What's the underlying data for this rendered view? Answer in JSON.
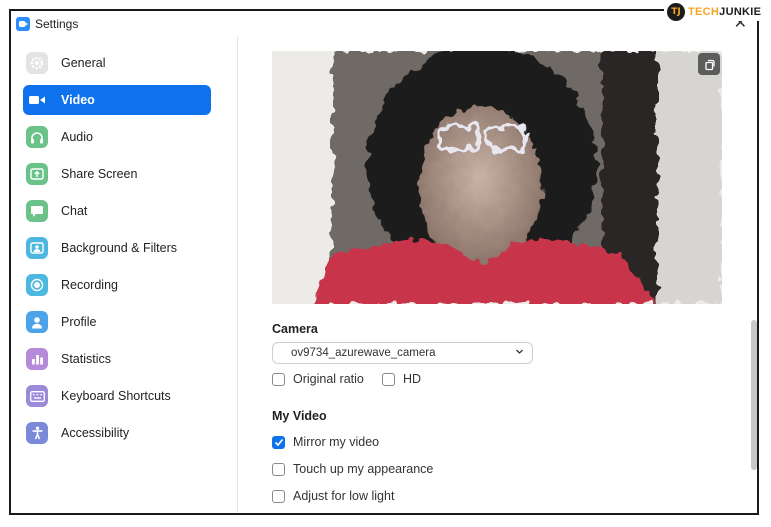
{
  "window": {
    "title": "Settings",
    "close": "✕"
  },
  "watermark": {
    "badge": "TJ",
    "part1": "TECH",
    "part2": "JUNKIE"
  },
  "sidebar": {
    "items": [
      {
        "label": "General",
        "icon": "gear-icon",
        "color": "#e0e0e0"
      },
      {
        "label": "Video",
        "icon": "video-camera-icon",
        "color": "#0e72ed",
        "active": true
      },
      {
        "label": "Audio",
        "icon": "headphones-icon",
        "color": "#6cc38a"
      },
      {
        "label": "Share Screen",
        "icon": "share-screen-icon",
        "color": "#6cc38a"
      },
      {
        "label": "Chat",
        "icon": "chat-bubble-icon",
        "color": "#6cc38a"
      },
      {
        "label": "Background & Filters",
        "icon": "background-icon",
        "color": "#4cb7df"
      },
      {
        "label": "Recording",
        "icon": "recording-icon",
        "color": "#4cb7df"
      },
      {
        "label": "Profile",
        "icon": "profile-icon",
        "color": "#4ca3ea"
      },
      {
        "label": "Statistics",
        "icon": "statistics-icon",
        "color": "#b48ad9"
      },
      {
        "label": "Keyboard Shortcuts",
        "icon": "keyboard-icon",
        "color": "#9b8ad9"
      },
      {
        "label": "Accessibility",
        "icon": "accessibility-icon",
        "color": "#7a8ad9"
      }
    ]
  },
  "video": {
    "camera_section": "Camera",
    "camera_selected": "ov9734_azurewave_camera",
    "original_ratio": {
      "label": "Original ratio",
      "checked": false
    },
    "hd": {
      "label": "HD",
      "checked": false
    },
    "my_video_section": "My Video",
    "mirror": {
      "label": "Mirror my video",
      "checked": true
    },
    "touch_up": {
      "label": "Touch up my appearance",
      "checked": false
    },
    "low_light": {
      "label": "Adjust for low light",
      "checked": false
    }
  }
}
